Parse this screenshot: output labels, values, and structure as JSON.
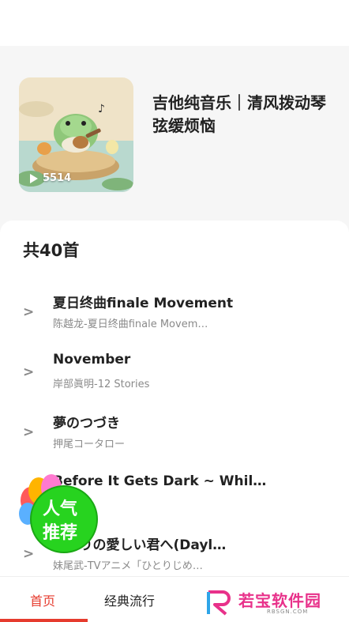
{
  "playlist": {
    "title": "吉他纯音乐｜清风拨动琴弦缓烦恼",
    "play_count": "5514"
  },
  "song_count": "共40首",
  "songs": [
    {
      "name": "夏日终曲finale Movement",
      "sub": "陈越龙-夏日终曲finale Movem…"
    },
    {
      "name": "November",
      "sub": "岸部眞明-12 Stories"
    },
    {
      "name": "夢のつづき",
      "sub": "押尾コータロー"
    },
    {
      "name": "Before It Gets Dark ~ While T…",
      "sub": ""
    },
    {
      "name": "ひとりの愛しい君へ(Dayl…",
      "sub": "妹尾武-TVアニメ「ひとりじめ…"
    }
  ],
  "arrow_glyph": ">",
  "badge": {
    "line1": "人气",
    "line2": "推荐"
  },
  "tabs": [
    {
      "label": "首页",
      "active": true
    },
    {
      "label": "经典流行",
      "active": false
    }
  ],
  "watermark": {
    "text": "若宝软件园",
    "sub": "RBSGN.COM"
  },
  "colors": {
    "accent": "#e63b2e",
    "badge_green": "#27d31f"
  }
}
